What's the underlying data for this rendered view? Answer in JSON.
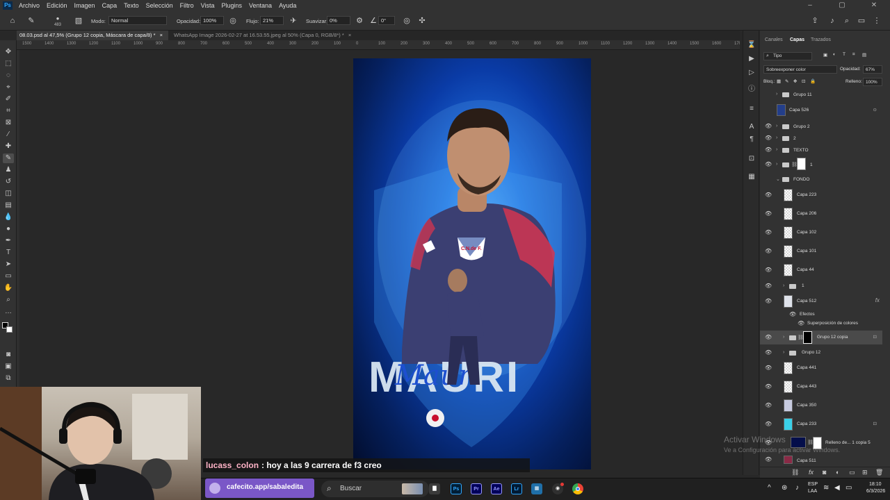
{
  "menubar": {
    "app_icon": "Ps",
    "items": [
      "Archivo",
      "Edición",
      "Imagen",
      "Capa",
      "Texto",
      "Selección",
      "Filtro",
      "Vista",
      "Plugins",
      "Ventana",
      "Ayuda"
    ]
  },
  "options": {
    "brush_size": "483",
    "mode_label": "Modo:",
    "mode_value": "Normal",
    "opacity_label": "Opacidad:",
    "opacity_value": "100%",
    "flow_label": "Flujo:",
    "flow_value": "21%",
    "smooth_label": "Suavizar:",
    "smooth_value": "0%",
    "angle_value": "0°"
  },
  "tabs": [
    {
      "label": "08.03.psd al 47,5% (Grupo 12 copia, Máscara de capa/8) *",
      "active": true
    },
    {
      "label": "WhatsApp Image 2026-02-27 at 16.53.55.jpeg al 50% (Capa 0, RGB/8*) *",
      "active": false
    }
  ],
  "ruler": [
    "1500",
    "1400",
    "1300",
    "1200",
    "1100",
    "1000",
    "900",
    "800",
    "700",
    "600",
    "500",
    "400",
    "300",
    "200",
    "100",
    "0",
    "100",
    "200",
    "300",
    "400",
    "500",
    "600",
    "700",
    "800",
    "900",
    "1000",
    "1100",
    "1200",
    "1300",
    "1400",
    "1500",
    "1600",
    "1700",
    "1800",
    "1900",
    "2000"
  ],
  "artwork": {
    "badge": "C.N.de F.",
    "big_text": "MAURI",
    "script_text": "Mauri"
  },
  "panel": {
    "tabs": [
      "Canales",
      "Capas",
      "Trazados"
    ],
    "active_tab": "Capas",
    "filter_label": "Tipo",
    "blend_mode": "Sobreexponer color",
    "opacity_label": "Opacidad:",
    "opacity_value": "67%",
    "lock_label": "Bloq.:",
    "fill_label": "Relleno:",
    "fill_value": "100%",
    "effects_label": "Efectos",
    "effect_item": "Superposición de colores",
    "layers": [
      {
        "name": "Grupo 11",
        "kind": "folder"
      },
      {
        "name": "Capa 526",
        "kind": "image"
      },
      {
        "name": "Grupo 2",
        "kind": "folder"
      },
      {
        "name": "2",
        "kind": "folder"
      },
      {
        "name": "TEXTO",
        "kind": "folder"
      },
      {
        "name": "1",
        "kind": "folder"
      },
      {
        "name": "FONDO",
        "kind": "folder"
      },
      {
        "name": "Capa 223",
        "kind": "layer"
      },
      {
        "name": "Capa 206",
        "kind": "layer"
      },
      {
        "name": "Capa 102",
        "kind": "layer"
      },
      {
        "name": "Capa 101",
        "kind": "layer"
      },
      {
        "name": "Capa 44",
        "kind": "layer"
      },
      {
        "name": "1",
        "kind": "folder"
      },
      {
        "name": "Capa 512",
        "kind": "image"
      },
      {
        "name": "Grupo 12 copia",
        "kind": "folder"
      },
      {
        "name": "Grupo 12",
        "kind": "folder"
      },
      {
        "name": "Capa 441",
        "kind": "layer"
      },
      {
        "name": "Capa 443",
        "kind": "layer"
      },
      {
        "name": "Capa 350",
        "kind": "layer"
      },
      {
        "name": "Capa 233",
        "kind": "layer"
      },
      {
        "name": "Relleno de... 1 copia 5",
        "kind": "fill"
      },
      {
        "name": "Capa 511",
        "kind": "layer"
      }
    ]
  },
  "chat": {
    "user": "lucass_colon",
    "message": ": hoy a las 9 carrera de f3 creo"
  },
  "cafecito": "cafecito.app/sabaledita",
  "taskbar": {
    "search_placeholder": "Buscar",
    "apps": [
      "Ps",
      "Pr",
      "Ae",
      "Lr"
    ],
    "lang_1": "ESP",
    "lang_2": "LAA",
    "time": "18:10",
    "date": "6/3/2026"
  },
  "watermark": {
    "line1": "Activar Windows",
    "line2": "Ve a Configuración para activar Windows."
  }
}
